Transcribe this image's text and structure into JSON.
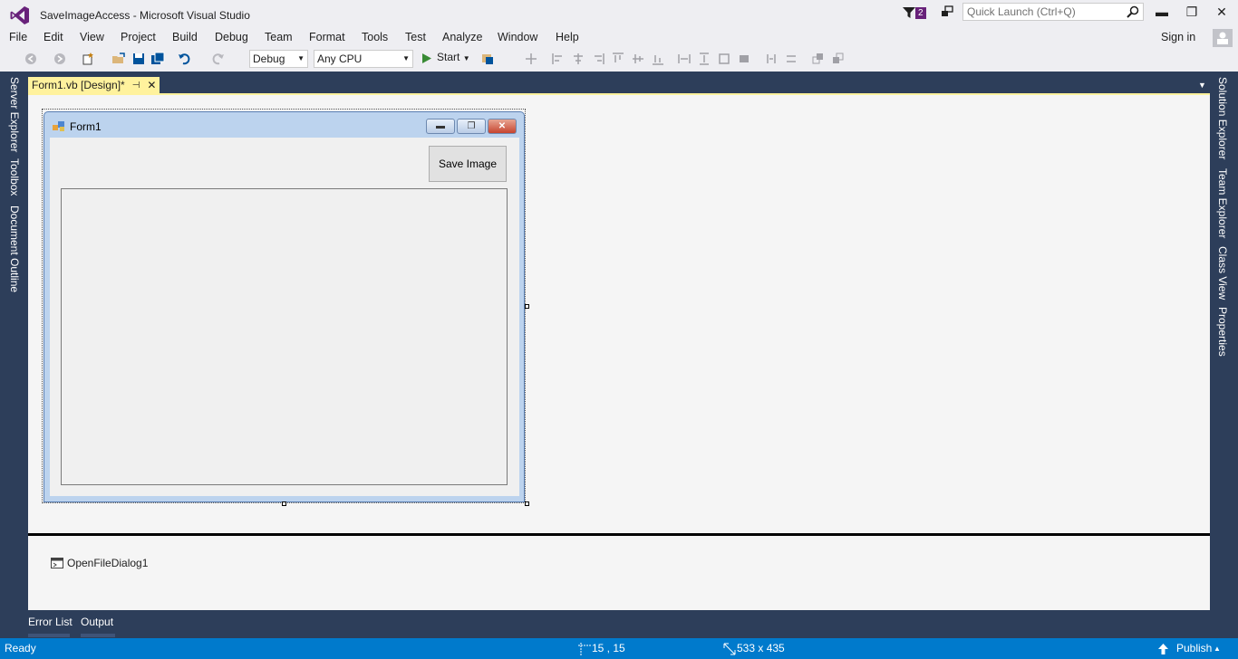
{
  "window": {
    "title": "SaveImageAccess - Microsoft Visual Studio",
    "notification_count": "2",
    "quick_launch_placeholder": "Quick Launch (Ctrl+Q)",
    "minimize_glyph": "▬",
    "maximize_glyph": "❐",
    "close_glyph": "✕"
  },
  "menu": {
    "items": [
      "File",
      "Edit",
      "View",
      "Project",
      "Build",
      "Debug",
      "Team",
      "Format",
      "Tools",
      "Test",
      "Analyze",
      "Window",
      "Help"
    ],
    "sign_in": "Sign in"
  },
  "toolbar": {
    "configuration": "Debug",
    "platform": "Any CPU",
    "start_label": "Start"
  },
  "side_tabs": {
    "left": [
      "Server Explorer",
      "Toolbox",
      "Document Outline"
    ],
    "right": [
      "Solution Explorer",
      "Team Explorer",
      "Class View",
      "Properties"
    ]
  },
  "document_tab": {
    "label": "Form1.vb [Design]*"
  },
  "form": {
    "caption": "Form1",
    "save_button_label": "Save Image"
  },
  "component_tray": {
    "items": [
      "OpenFileDialog1"
    ]
  },
  "bottom_tabs": [
    "Error List",
    "Output"
  ],
  "status": {
    "state": "Ready",
    "position": "15 , 15",
    "size": "533 x 435",
    "publish": "Publish"
  },
  "colors": {
    "accent": "#007acc",
    "chrome_dark": "#2d3e5a",
    "tab_active": "#fff29d",
    "vs_purple": "#68217a"
  }
}
